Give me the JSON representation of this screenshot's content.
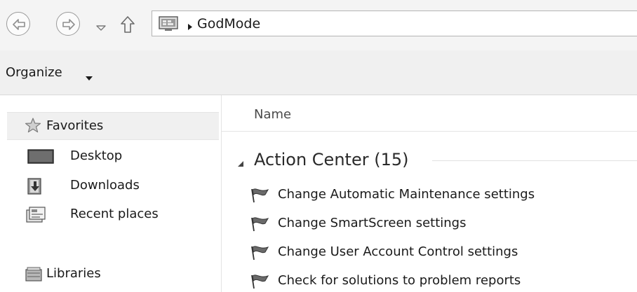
{
  "address_bar": {
    "location": "GodMode",
    "icons": {
      "back": "back-arrow-icon",
      "forward": "forward-arrow-icon",
      "recent": "chevron-down-icon",
      "up": "up-arrow-icon",
      "location": "control-panel-icon",
      "separator": "breadcrumb-arrow-icon"
    }
  },
  "toolbar": {
    "organize_label": "Organize"
  },
  "nav_pane": {
    "favorites": "Favorites",
    "desktop": "Desktop",
    "downloads": "Downloads",
    "recent_places": "Recent places",
    "libraries": "Libraries"
  },
  "content": {
    "column_name": "Name",
    "group_title": "Action Center (15)",
    "tasks": [
      "Change Automatic Maintenance settings",
      "Change SmartScreen settings",
      "Change User Account Control settings",
      "Check for solutions to problem reports"
    ]
  },
  "colors": {
    "address_row_bg": "#f4f4f4",
    "toolbar_bg": "#f0f0f0",
    "selected_nav_bg": "#f0f0f0",
    "text": "#1a1a1a"
  }
}
